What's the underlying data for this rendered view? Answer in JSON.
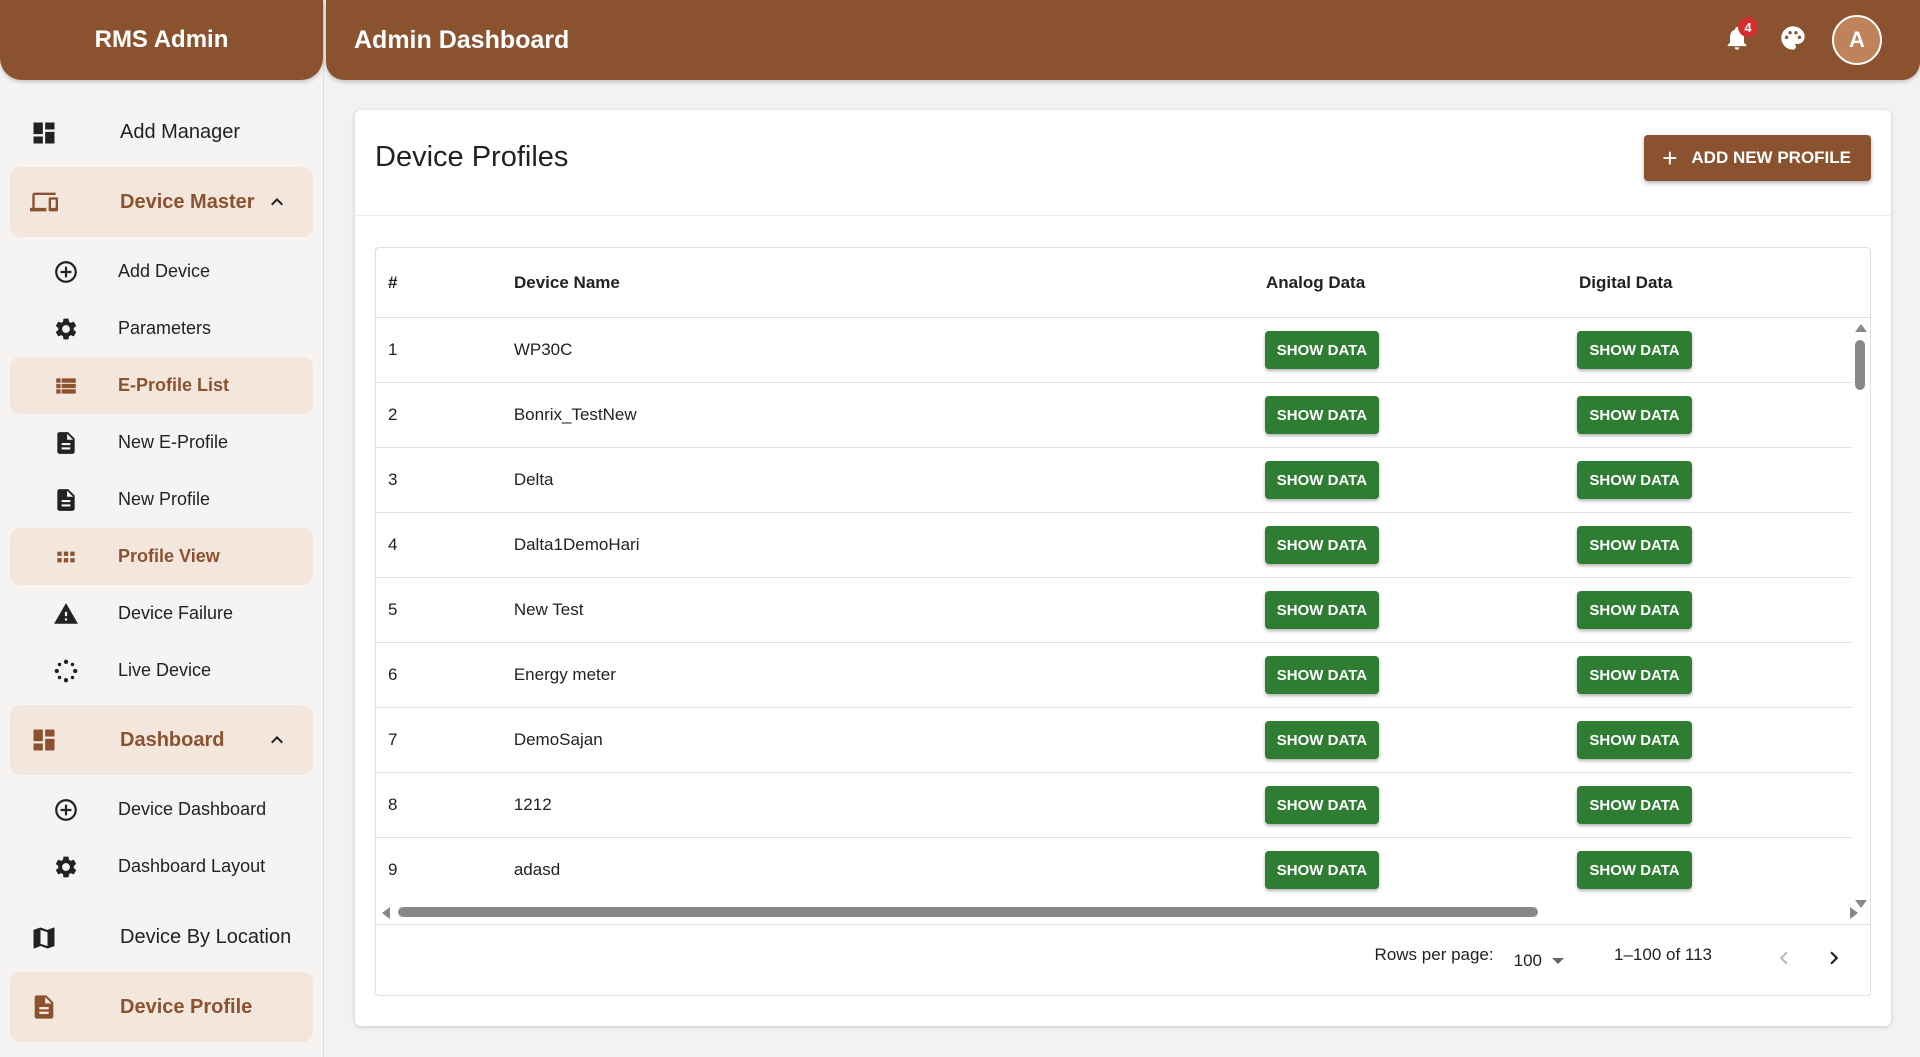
{
  "app": {
    "name": "RMS Admin"
  },
  "header": {
    "title": "Admin Dashboard",
    "notification_count": "4",
    "avatar_letter": "A"
  },
  "sidebar": {
    "add_manager": "Add Manager",
    "device_master": {
      "label": "Device Master",
      "items": [
        {
          "label": "Add Device",
          "icon": "add-circle-icon"
        },
        {
          "label": "Parameters",
          "icon": "gear-icon"
        },
        {
          "label": "E-Profile List",
          "icon": "list-icon",
          "active": true
        },
        {
          "label": "New E-Profile",
          "icon": "document-icon"
        },
        {
          "label": "New Profile",
          "icon": "document-icon"
        },
        {
          "label": "Profile View",
          "icon": "grid-view-icon",
          "active": true
        },
        {
          "label": "Device Failure",
          "icon": "warning-icon"
        },
        {
          "label": "Live Device",
          "icon": "loading-icon"
        }
      ]
    },
    "dashboard": {
      "label": "Dashboard",
      "items": [
        {
          "label": "Device Dashboard",
          "icon": "add-circle-icon"
        },
        {
          "label": "Dashboard Layout",
          "icon": "gear-icon"
        }
      ]
    },
    "device_by_location": "Device By Location",
    "device_profile": "Device Profile"
  },
  "page": {
    "title": "Device Profiles",
    "add_button": "ADD NEW PROFILE"
  },
  "table": {
    "headers": {
      "num": "#",
      "name": "Device Name",
      "analog": "Analog Data",
      "digital": "Digital Data"
    },
    "button_label": "SHOW DATA",
    "rows": [
      {
        "num": "1",
        "name": "WP30C"
      },
      {
        "num": "2",
        "name": "Bonrix_TestNew"
      },
      {
        "num": "3",
        "name": "Delta"
      },
      {
        "num": "4",
        "name": "Dalta1DemoHari"
      },
      {
        "num": "5",
        "name": "New Test"
      },
      {
        "num": "6",
        "name": "Energy meter"
      },
      {
        "num": "7",
        "name": "DemoSajan"
      },
      {
        "num": "8",
        "name": "1212"
      },
      {
        "num": "9",
        "name": "adasd"
      }
    ]
  },
  "pagination": {
    "rows_per_page_label": "Rows per page:",
    "rows_per_page": "100",
    "range": "1–100 of 113"
  },
  "colors": {
    "brand": "#8b5230",
    "brand_light": "#f3e6dc",
    "success": "#2e7d32"
  }
}
